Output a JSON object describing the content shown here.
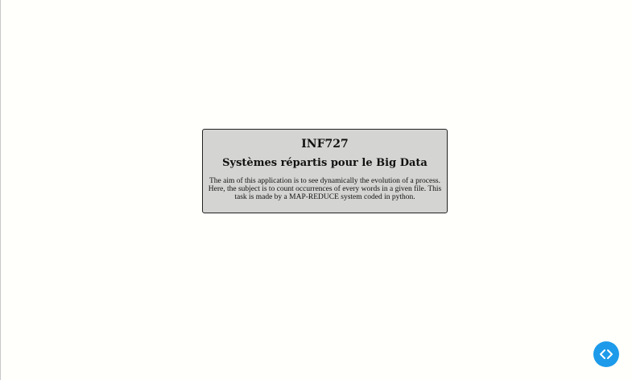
{
  "card": {
    "code": "INF727",
    "title": "Systèmes répartis pour le Big Data",
    "description": "The aim of this application is to see dynamically the evolution of a process. Here, the subject is to count occurrences of every words in a given file. This task is made by a MAP-REDUCE system coded in python."
  },
  "fab": {
    "icon": "code-brackets-icon",
    "color": "#1d9bea"
  }
}
